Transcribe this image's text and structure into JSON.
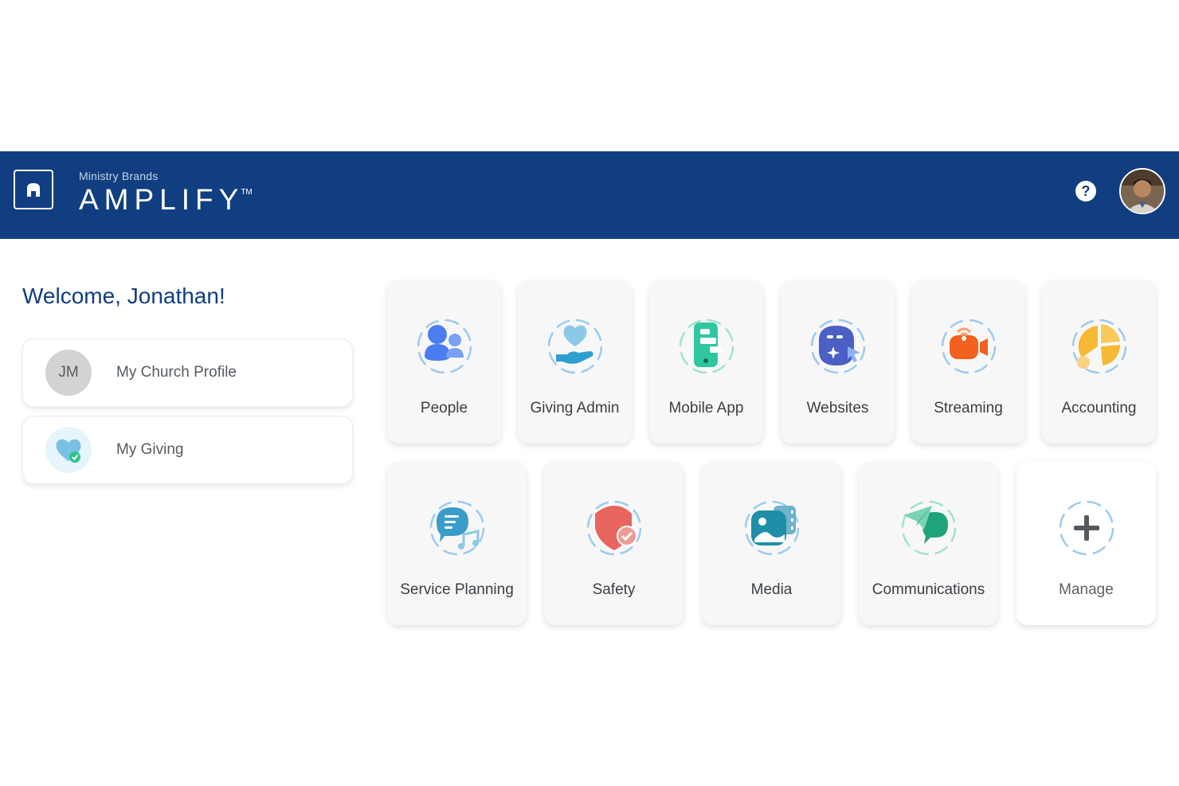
{
  "header": {
    "brand_sub": "Ministry Brands",
    "brand_name": "AMPLIFY",
    "trademark": "TM",
    "help_label": "?",
    "background": "#113e80"
  },
  "welcome": "Welcome, Jonathan!",
  "side_cards": [
    {
      "initials": "JM",
      "label": "My Church Profile"
    },
    {
      "icon": "heart-check-icon",
      "label": "My Giving"
    }
  ],
  "apps": [
    {
      "label": "People",
      "icon": "people-icon",
      "color": "#4a7ef0"
    },
    {
      "label": "Giving Admin",
      "icon": "hand-heart-icon",
      "color": "#2f9fd1"
    },
    {
      "label": "Mobile App",
      "icon": "mobile-app-icon",
      "color": "#2fc7a0"
    },
    {
      "label": "Websites",
      "icon": "website-icon",
      "color": "#4b5fc4"
    },
    {
      "label": "Streaming",
      "icon": "video-camera-icon",
      "color": "#f2611d"
    },
    {
      "label": "Accounting",
      "icon": "pie-chart-icon",
      "color": "#f7b833"
    },
    {
      "label": "Service Planning",
      "icon": "chat-music-icon",
      "color": "#3a9dc9"
    },
    {
      "label": "Safety",
      "icon": "shield-check-icon",
      "color": "#e8645f"
    },
    {
      "label": "Media",
      "icon": "media-gallery-icon",
      "color": "#1f8fa8"
    },
    {
      "label": "Communications",
      "icon": "paper-plane-chat-icon",
      "color": "#20a37a"
    },
    {
      "label": "Manage",
      "icon": "plus-icon",
      "color": "#555a5f"
    }
  ]
}
